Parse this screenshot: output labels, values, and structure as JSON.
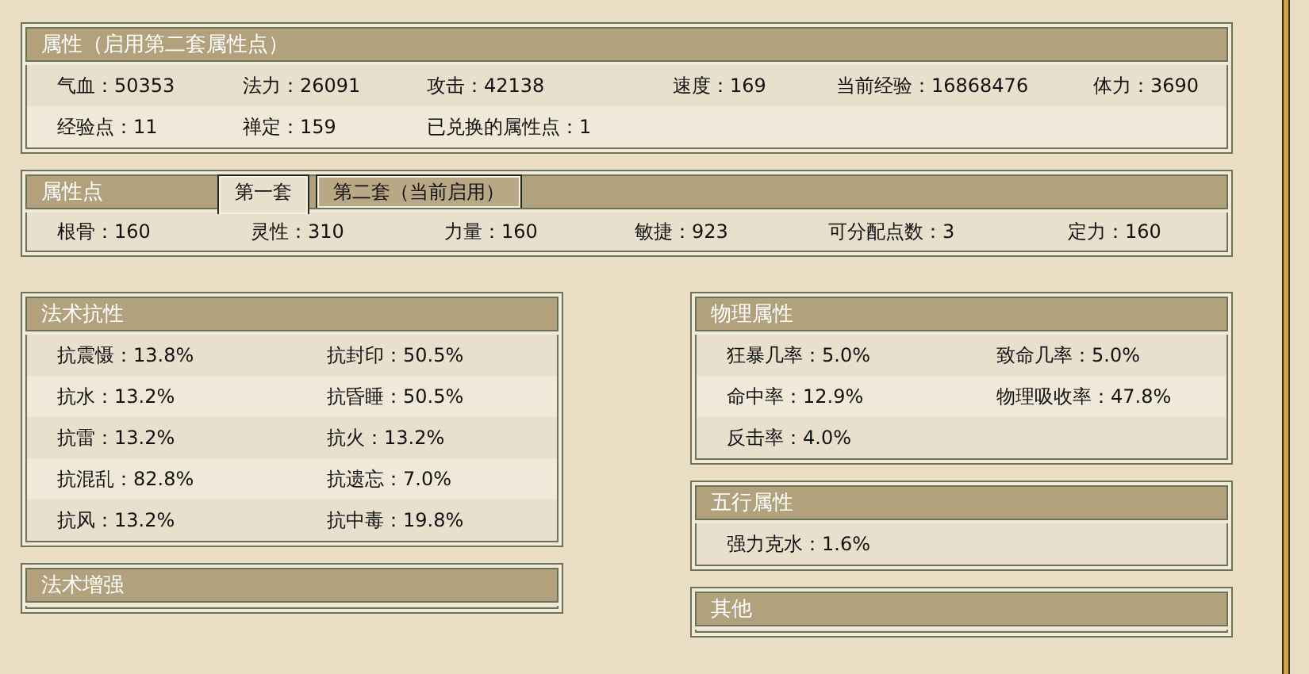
{
  "attributes": {
    "title": "属性（启用第二套属性点）",
    "rows": [
      [
        "气血：50353",
        "法力：26091",
        "攻击：42138",
        "速度：169",
        "当前经验：16868476",
        "体力：3690"
      ],
      [
        "经验点：11",
        "禅定：159",
        "已兑换的属性点：1"
      ]
    ]
  },
  "points": {
    "title": "属性点",
    "tabs": [
      {
        "label": "第一套",
        "selected": true
      },
      {
        "label": "第二套（当前启用）",
        "selected": false
      }
    ],
    "stats": [
      "根骨：160",
      "灵性：310",
      "力量：160",
      "敏捷：923",
      "可分配点数：3",
      "定力：160"
    ]
  },
  "left_panels": [
    {
      "title": "法术抗性",
      "rows": [
        [
          "抗震慑：13.8%",
          "抗封印：50.5%"
        ],
        [
          "抗水：13.2%",
          "抗昏睡：50.5%"
        ],
        [
          "抗雷：13.2%",
          "抗火：13.2%"
        ],
        [
          "抗混乱：82.8%",
          "抗遗忘：7.0%"
        ],
        [
          "抗风：13.2%",
          "抗中毒：19.8%"
        ]
      ]
    },
    {
      "title": "法术增强"
    }
  ],
  "right_panels": [
    {
      "title": "物理属性",
      "rows": [
        [
          "狂暴几率：5.0%",
          "致命几率：5.0%"
        ],
        [
          "命中率：12.9%",
          "物理吸收率：47.8%"
        ],
        [
          "反击率：4.0%"
        ]
      ]
    },
    {
      "title": "五行属性",
      "rows": [
        [
          "强力克水：1.6%"
        ]
      ]
    },
    {
      "title": "其他"
    }
  ]
}
